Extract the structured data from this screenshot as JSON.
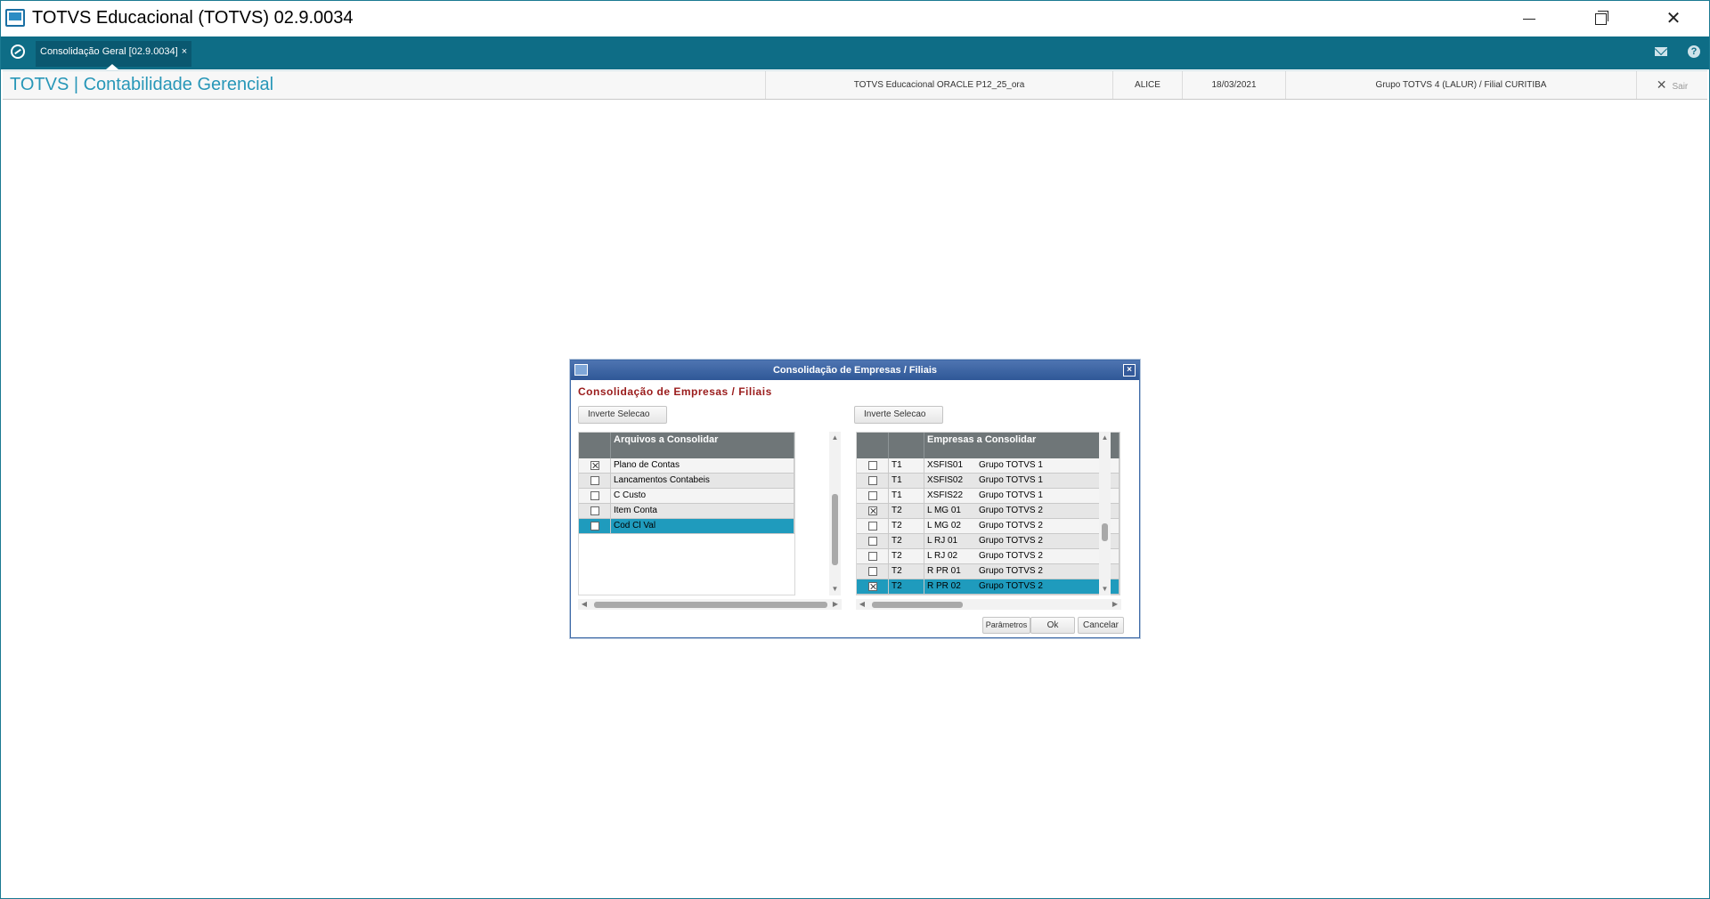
{
  "window": {
    "title": "TOTVS Educacional (TOTVS) 02.9.0034"
  },
  "tabbar": {
    "active_tab": "Consolidação Geral [02.9.0034]",
    "tab_close": "×",
    "help_glyph": "?"
  },
  "infobar": {
    "module_title": "TOTVS | Contabilidade Gerencial",
    "environment": "TOTVS Educacional ORACLE P12_25_ora",
    "user": "ALICE",
    "date": "18/03/2021",
    "group": "Grupo TOTVS 4  (LALUR) / Filial CURITIBA",
    "exit_label": "Sair",
    "exit_glyph": "✕"
  },
  "dialog": {
    "title": "Consolidação de Empresas / Filiais",
    "close_glyph": "×",
    "heading": "Consolidação de Empresas / Filiais",
    "invert_left": "Inverte Selecao",
    "invert_right": "Inverte Selecao",
    "left_grid": {
      "header": "Arquivos a Consolidar",
      "rows": [
        {
          "label": "Plano de Contas",
          "checked": true,
          "selected": false
        },
        {
          "label": "Lancamentos Contabeis",
          "checked": false,
          "selected": false
        },
        {
          "label": "C Custo",
          "checked": false,
          "selected": false
        },
        {
          "label": "Item Conta",
          "checked": false,
          "selected": false
        },
        {
          "label": "Cod Cl Val",
          "checked": false,
          "selected": true
        }
      ]
    },
    "right_grid": {
      "header": "Empresas a Consolidar",
      "rows": [
        {
          "code": "T1",
          "branch": "XSFIS01",
          "group": "Grupo TOTVS 1",
          "checked": false,
          "selected": false
        },
        {
          "code": "T1",
          "branch": "XSFIS02",
          "group": "Grupo TOTVS 1",
          "checked": false,
          "selected": false
        },
        {
          "code": "T1",
          "branch": "XSFIS22",
          "group": "Grupo TOTVS 1",
          "checked": false,
          "selected": false
        },
        {
          "code": "T2",
          "branch": "L MG 01",
          "group": "Grupo TOTVS 2",
          "checked": true,
          "selected": false
        },
        {
          "code": "T2",
          "branch": "L MG 02",
          "group": "Grupo TOTVS 2",
          "checked": false,
          "selected": false
        },
        {
          "code": "T2",
          "branch": "L RJ 01",
          "group": "Grupo TOTVS 2",
          "checked": false,
          "selected": false
        },
        {
          "code": "T2",
          "branch": "L RJ 02",
          "group": "Grupo TOTVS 2",
          "checked": false,
          "selected": false
        },
        {
          "code": "T2",
          "branch": "R PR 01",
          "group": "Grupo TOTVS 2",
          "checked": false,
          "selected": false
        },
        {
          "code": "T2",
          "branch": "R PR 02",
          "group": "Grupo TOTVS 2",
          "checked": true,
          "selected": true
        }
      ]
    },
    "buttons": {
      "params": "Parâmetros",
      "ok": "Ok",
      "cancel": "Cancelar"
    }
  },
  "colors": {
    "accent_teal": "#0e6d86",
    "module_title": "#2897b8",
    "selection": "#1f9bbd",
    "dialog_heading": "#9a1b1b"
  },
  "icons": {
    "app": "monitor-icon",
    "home": "home-icon",
    "mail": "mail-icon",
    "help": "help-icon"
  }
}
